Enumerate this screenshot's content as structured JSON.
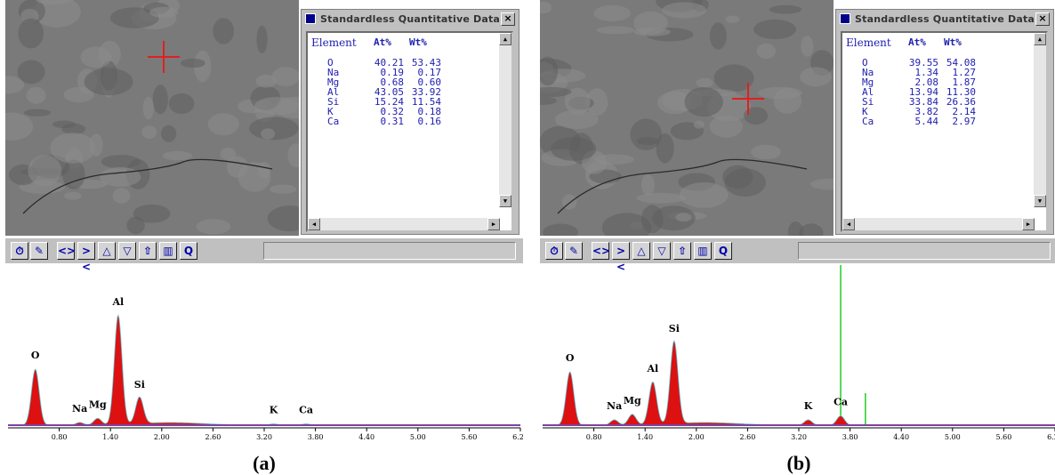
{
  "panels": [
    {
      "id": "a",
      "caption": "(a)",
      "dialog": {
        "title": "Standardless Quantitative Data",
        "close_label": "×",
        "headers": {
          "element": "Element",
          "at": "At%",
          "wt": "Wt%"
        },
        "rows": [
          {
            "el": "O",
            "at": "40.21",
            "wt": "53.43"
          },
          {
            "el": "Na",
            "at": "0.19",
            "wt": "0.17"
          },
          {
            "el": "Mg",
            "at": "0.68",
            "wt": "0.60"
          },
          {
            "el": "Al",
            "at": "43.05",
            "wt": "33.92"
          },
          {
            "el": "Si",
            "at": "15.24",
            "wt": "11.54"
          },
          {
            "el": "K",
            "at": "0.32",
            "wt": "0.18"
          },
          {
            "el": "Ca",
            "at": "0.31",
            "wt": "0.16"
          }
        ]
      },
      "spectrum": {
        "peaks": [
          {
            "label": "O",
            "kev": 0.52,
            "h": 0.42
          },
          {
            "label": "Na",
            "kev": 1.04,
            "h": 0.02
          },
          {
            "label": "Mg",
            "kev": 1.25,
            "h": 0.05
          },
          {
            "label": "Al",
            "kev": 1.49,
            "h": 0.82
          },
          {
            "label": "Si",
            "kev": 1.74,
            "h": 0.2
          },
          {
            "label": "K",
            "kev": 3.31,
            "h": 0.01
          },
          {
            "label": "Ca",
            "kev": 3.69,
            "h": 0.01
          }
        ],
        "markers": []
      }
    },
    {
      "id": "b",
      "caption": "(b)",
      "dialog": {
        "title": "Standardless Quantitative Data",
        "close_label": "×",
        "headers": {
          "element": "Element",
          "at": "At%",
          "wt": "Wt%"
        },
        "rows": [
          {
            "el": "O",
            "at": "39.55",
            "wt": "54.08"
          },
          {
            "el": "Na",
            "at": "1.34",
            "wt": "1.27"
          },
          {
            "el": "Mg",
            "at": "2.08",
            "wt": "1.87"
          },
          {
            "el": "Al",
            "at": "13.94",
            "wt": "11.30"
          },
          {
            "el": "Si",
            "at": "33.84",
            "wt": "26.36"
          },
          {
            "el": "K",
            "at": "3.82",
            "wt": "2.14"
          },
          {
            "el": "Ca",
            "at": "5.44",
            "wt": "2.97"
          }
        ]
      },
      "spectrum": {
        "peaks": [
          {
            "label": "O",
            "kev": 0.52,
            "h": 0.4
          },
          {
            "label": "Na",
            "kev": 1.04,
            "h": 0.04
          },
          {
            "label": "Mg",
            "kev": 1.25,
            "h": 0.08
          },
          {
            "label": "Al",
            "kev": 1.49,
            "h": 0.32
          },
          {
            "label": "Si",
            "kev": 1.74,
            "h": 0.62
          },
          {
            "label": "K",
            "kev": 3.31,
            "h": 0.04
          },
          {
            "label": "Ca",
            "kev": 3.69,
            "h": 0.07
          }
        ],
        "markers": [
          {
            "kev": 0.0,
            "h": 1.0,
            "color": "#40e0e0"
          },
          {
            "kev": 3.69,
            "h": 1.0,
            "color": "#22cc22"
          },
          {
            "kev": 3.98,
            "h": 0.2,
            "color": "#22cc22"
          }
        ]
      }
    }
  ],
  "spectrum_axis": {
    "kev_min": 0.2,
    "kev_max": 6.2,
    "ticks": [
      "0.80",
      "1.40",
      "2.00",
      "2.60",
      "3.20",
      "3.80",
      "4.40",
      "5.00",
      "5.60",
      "6.20"
    ]
  },
  "toolbar_icons": [
    "clock-icon",
    "edit-icon",
    "expand-icon",
    "contract-icon",
    "up-icon",
    "down-icon",
    "export-icon",
    "spectrum-icon",
    "zoom-icon"
  ],
  "colors": {
    "fill": "#dd1111",
    "baseline": "#8040a0",
    "peak_outline": "#5fc8d8",
    "text": "#2020b0"
  }
}
